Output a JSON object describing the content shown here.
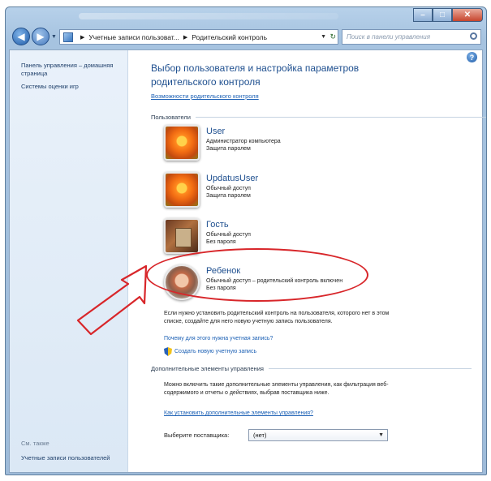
{
  "window": {
    "controls": {
      "minimize": "–",
      "maximize": "□",
      "close": "✕"
    }
  },
  "address": {
    "crumbs": [
      "Учетные записи пользоват...",
      "Родительский контроль"
    ],
    "search_placeholder": "Поиск в панели управления"
  },
  "sidebar": {
    "items": [
      {
        "label": "Панель управления – домашняя страница"
      },
      {
        "label": "Системы оценки игр"
      }
    ],
    "see_also_title": "См. также",
    "see_also_items": [
      {
        "label": "Учетные записи пользователей"
      }
    ]
  },
  "main": {
    "title": "Выбор пользователя и настройка параметров родительского контроля",
    "title_link": "Возможности родительского контроля",
    "users_heading": "Пользователи",
    "users": [
      {
        "name": "User",
        "line1": "Администратор компьютера",
        "line2": "Защита паролем",
        "avatar": "flower-icon"
      },
      {
        "name": "UpdatusUser",
        "line1": "Обычный доступ",
        "line2": "Защита паролем",
        "avatar": "flower-icon"
      },
      {
        "name": "Гость",
        "line1": "Обычный доступ",
        "line2": "Без пароля",
        "avatar": "guest-icon"
      },
      {
        "name": "Ребенок",
        "line1": "Обычный доступ – родительский контроль включен",
        "line2": "Без пароля",
        "avatar": "child-icon"
      }
    ],
    "description": "Если нужно установить родительский контроль на пользователя, которого нет в этом списке, создайте для него новую учетную запись пользователя.",
    "why_link": "Почему для этого нужна учетная запись?",
    "create_link": "Создать новую учетную запись",
    "extra_heading": "Дополнительные элементы управления",
    "extra_description": "Можно включить такие дополнительные элементы управления, как фильтрация веб-содержимого и отчеты о действиях, выбрав поставщика ниже.",
    "extra_link": "Как установить дополнительные элементы управления?",
    "provider_label": "Выберите поставщика:",
    "provider_value": "(нет)"
  },
  "colors": {
    "highlight": "#d8262a",
    "link": "#1a5fb4",
    "title": "#1e4f8f"
  }
}
